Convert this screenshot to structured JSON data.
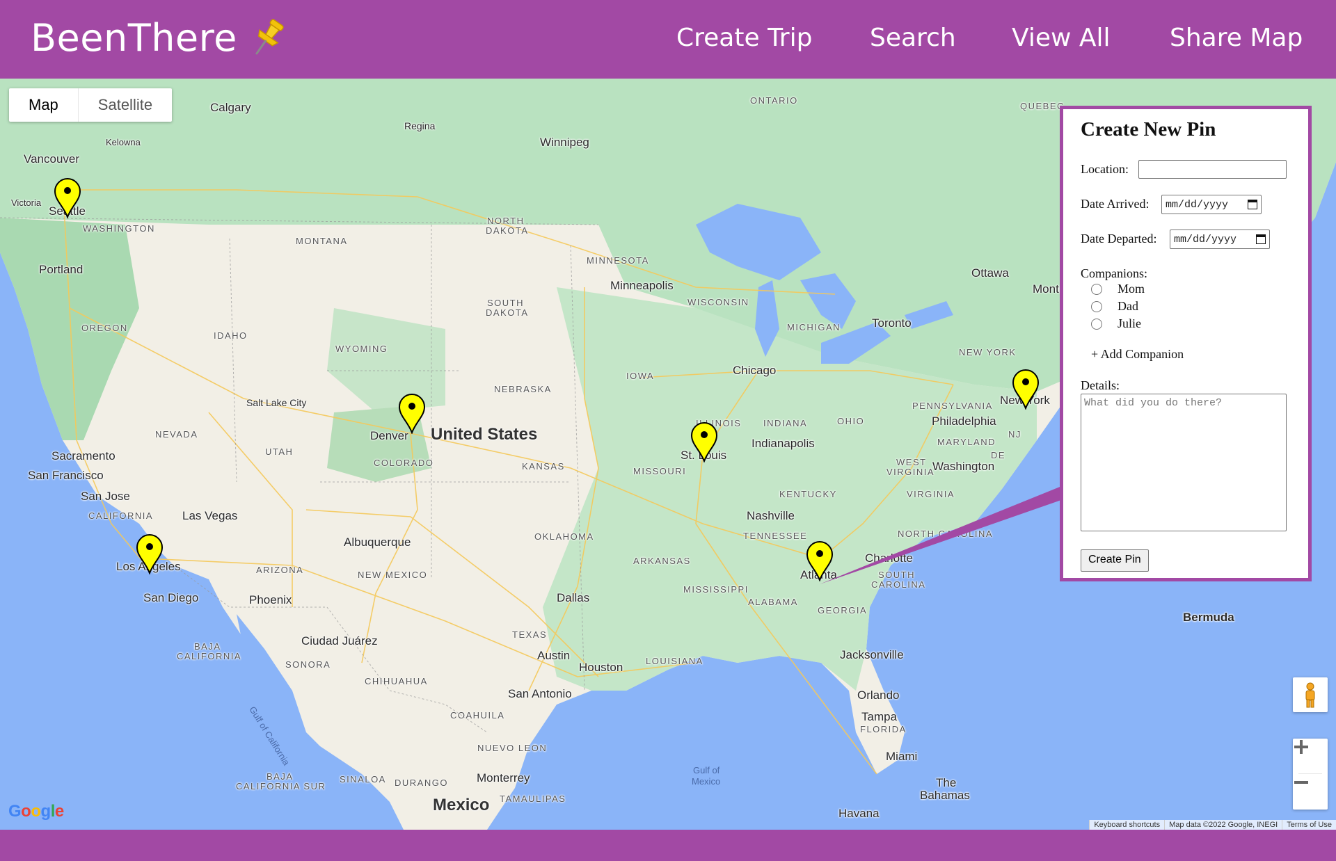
{
  "header": {
    "brand": "BeenThere",
    "nav": {
      "create_trip": "Create Trip",
      "search": "Search",
      "view_all": "View All",
      "share_map": "Share Map"
    }
  },
  "map": {
    "toggle": {
      "map": "Map",
      "satellite": "Satellite"
    },
    "labels": {
      "calgary": "Calgary",
      "regina": "Regina",
      "winnipeg": "Winnipeg",
      "ontario": "ONTARIO",
      "quebec": "QUEBEC",
      "kelowna": "Kelowna",
      "vancouver": "Vancouver",
      "victoria": "Victoria",
      "seattle": "Seattle",
      "washington_state": "WASHINGTON",
      "portland": "Portland",
      "oregon": "OREGON",
      "idaho": "IDAHO",
      "montana": "MONTANA",
      "wyoming": "WYOMING",
      "north_dakota_1": "NORTH",
      "north_dakota_2": "DAKOTA",
      "south_dakota_1": "SOUTH",
      "south_dakota_2": "DAKOTA",
      "minnesota": "MINNESOTA",
      "minneapolis": "Minneapolis",
      "wisconsin": "WISCONSIN",
      "michigan": "MICHIGAN",
      "toronto": "Toronto",
      "ottawa": "Ottawa",
      "montreal": "Montreal",
      "new_york_state": "NEW YORK",
      "new_york": "New York",
      "pennsylvania": "PENNSYLVANIA",
      "philadelphia": "Philadelphia",
      "maryland": "MARYLAND",
      "washington_dc": "Washington",
      "nj": "NJ",
      "de": "DE",
      "west_virginia_1": "WEST",
      "west_virginia_2": "VIRGINIA",
      "virginia": "VIRGINIA",
      "ohio": "OHIO",
      "indiana": "INDIANA",
      "indianapolis": "Indianapolis",
      "illinois": "ILLINOIS",
      "chicago": "Chicago",
      "iowa": "IOWA",
      "nebraska": "NEBRASKA",
      "kansas": "KANSAS",
      "missouri": "MISSOURI",
      "st_louis": "St. Louis",
      "kentucky": "KENTUCKY",
      "nashville": "Nashville",
      "tennessee": "TENNESSEE",
      "north_carolina": "NORTH CAROLINA",
      "charlotte": "Charlotte",
      "south_carolina_1": "SOUTH",
      "south_carolina_2": "CAROLINA",
      "atlanta": "Atlanta",
      "georgia": "GEORGIA",
      "alabama": "ALABAMA",
      "mississippi": "MISSISSIPPI",
      "arkansas": "ARKANSAS",
      "oklahoma": "OKLAHOMA",
      "dallas": "Dallas",
      "texas": "TEXAS",
      "austin": "Austin",
      "houston": "Houston",
      "louisiana": "LOUISIANA",
      "san_antonio": "San Antonio",
      "jacksonville": "Jacksonville",
      "orlando": "Orlando",
      "tampa": "Tampa",
      "florida": "FLORIDA",
      "miami": "Miami",
      "bahamas_1": "The",
      "bahamas_2": "Bahamas",
      "havana": "Havana",
      "bermuda": "Bermuda",
      "gulf_mexico_1": "Gulf of",
      "gulf_mexico_2": "Mexico",
      "mexico": "Mexico",
      "monterrey": "Monterrey",
      "nuevo_leon": "NUEVO LEON",
      "coahuila": "COAHUILA",
      "tamaulipas": "TAMAULIPAS",
      "durango": "DURANGO",
      "sinaloa": "SINALOA",
      "chihuahua": "CHIHUAHUA",
      "sonora": "SONORA",
      "ciudad_juarez": "Ciudad Juárez",
      "baja_california_1": "BAJA",
      "baja_california_2": "CALIFORNIA",
      "baja_california_sur_1": "BAJA",
      "baja_california_sur_2": "CALIFORNIA SUR",
      "gulf_california": "Gulf of California",
      "new_mexico": "NEW MEXICO",
      "albuquerque": "Albuquerque",
      "arizona": "ARIZONA",
      "phoenix": "Phoenix",
      "las_vegas": "Las Vegas",
      "los_angeles": "Los Angeles",
      "san_diego": "San Diego",
      "california": "CALIFORNIA",
      "san_jose": "San Jose",
      "san_francisco": "San Francisco",
      "sacramento": "Sacramento",
      "nevada": "NEVADA",
      "utah": "UTAH",
      "salt_lake_city": "Salt Lake City",
      "colorado": "COLORADO",
      "denver": "Denver",
      "united_states": "United States"
    },
    "attribution": {
      "keyboard": "Keyboard shortcuts",
      "data": "Map data ©2022 Google, INEGI",
      "terms": "Terms of Use"
    },
    "google": "Google"
  },
  "pins": [
    "Seattle",
    "Los Angeles",
    "Denver",
    "St. Louis",
    "Atlanta",
    "New York"
  ],
  "form": {
    "title": "Create New Pin",
    "location_label": "Location:",
    "location_value": "",
    "date_arrived_label": "Date Arrived:",
    "date_arrived_placeholder": "mm/dd/yyyy",
    "date_departed_label": "Date Departed:",
    "date_departed_placeholder": "mm/dd/yyyy",
    "companions_label": "Companions:",
    "companions": [
      "Mom",
      "Dad",
      "Julie"
    ],
    "add_companion": "+ Add Companion",
    "details_label": "Details:",
    "details_placeholder": "What did you do there?",
    "submit": "Create Pin"
  },
  "colors": {
    "brand": "#a249a4",
    "pin": "#ffff00",
    "water": "#8ab4f8",
    "land": "#b9e2c0"
  }
}
